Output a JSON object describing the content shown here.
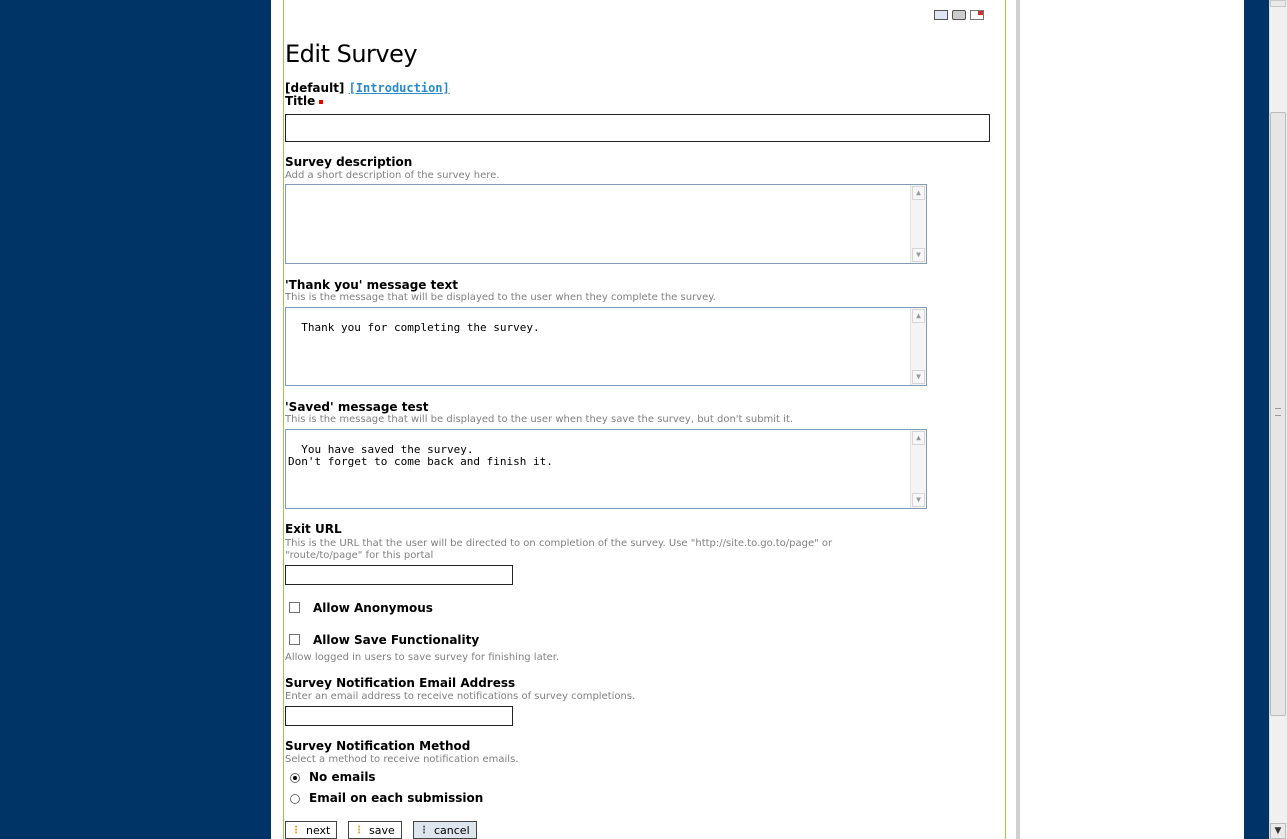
{
  "page": {
    "title": "Edit Survey",
    "tabs": {
      "current": "[default]",
      "link": "[Introduction]"
    },
    "toolbar_icons": [
      "email-icon",
      "print-icon",
      "popup-icon"
    ]
  },
  "form": {
    "title_field": {
      "label": "Title",
      "value": ""
    },
    "description": {
      "label": "Survey description",
      "help": "Add a short description of the survey here.",
      "value": ""
    },
    "thank_you": {
      "label": "'Thank you' message text",
      "help": "This is the message that will be displayed to the user when they complete the survey.",
      "value": "Thank you for completing the survey."
    },
    "saved": {
      "label": "'Saved' message test",
      "help": "This is the message that will be displayed to the user when they save the survey, but don't submit it.",
      "value": "You have saved the survey.\nDon't forget to come back and finish it."
    },
    "exit_url": {
      "label": "Exit URL",
      "help_line1": "This is the URL that the user will be directed to on completion of the survey. Use \"http://site.to.go.to/page\" or",
      "help_line2": "\"route/to/page\" for this portal",
      "value": ""
    },
    "allow_anonymous": {
      "label": "Allow Anonymous",
      "checked": false
    },
    "allow_save": {
      "label": "Allow Save Functionality",
      "help": "Allow logged in users to save survey for finishing later.",
      "checked": false
    },
    "notification_email": {
      "label": "Survey Notification Email Address",
      "help": "Enter an email address to receive notifications of survey completions.",
      "value": ""
    },
    "notification_method": {
      "label": "Survey Notification Method",
      "help": "Select a method to receive notification emails.",
      "options": [
        {
          "label": "No emails",
          "selected": true
        },
        {
          "label": "Email on each submission",
          "selected": false
        }
      ]
    }
  },
  "buttons": {
    "next": "next",
    "save": "save",
    "cancel": "cancel"
  }
}
